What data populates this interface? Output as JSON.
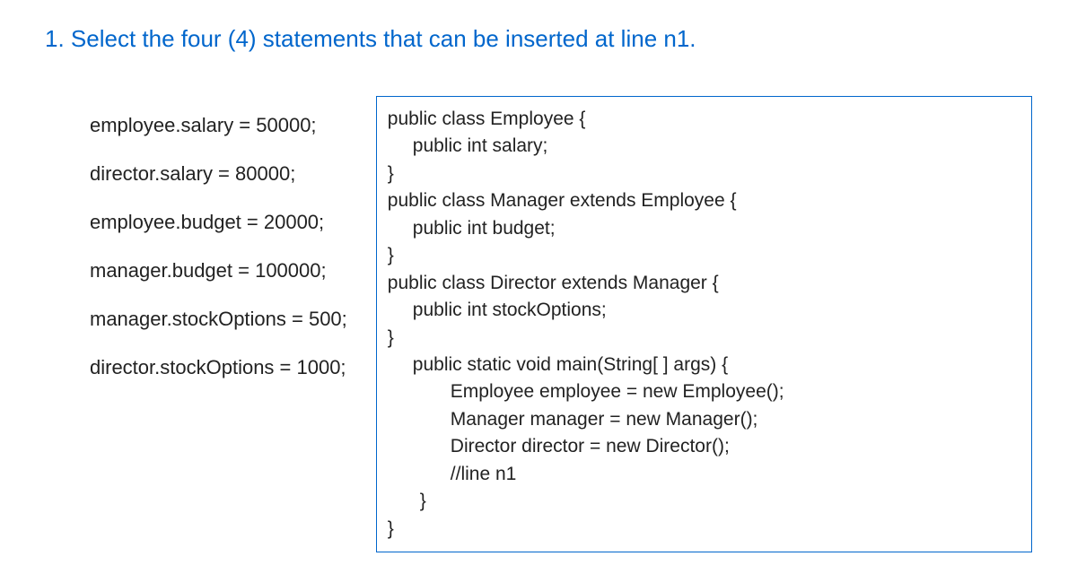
{
  "question": {
    "title": "1. Select the four (4) statements that can be inserted at line n1."
  },
  "options": [
    "employee.salary = 50000;",
    "director.salary = 80000;",
    "employee.budget = 20000;",
    "manager.budget = 100000;",
    "manager.stockOptions = 500;",
    "director.stockOptions = 1000;"
  ],
  "code": {
    "l0": "public class Employee {",
    "l1": "public int salary;",
    "l2": "}",
    "l3": "public class Manager extends Employee {",
    "l4": "public int budget;",
    "l5": "}",
    "l6": "public class Director extends Manager {",
    "l7": "public int stockOptions;",
    "l8": "}",
    "l9": "public static void main(String[ ] args) {",
    "l10": "Employee employee = new Employee();",
    "l11": "Manager manager = new Manager();",
    "l12": "Director director = new Director();",
    "l13": "//line n1",
    "l14": "}",
    "l15": "}"
  }
}
